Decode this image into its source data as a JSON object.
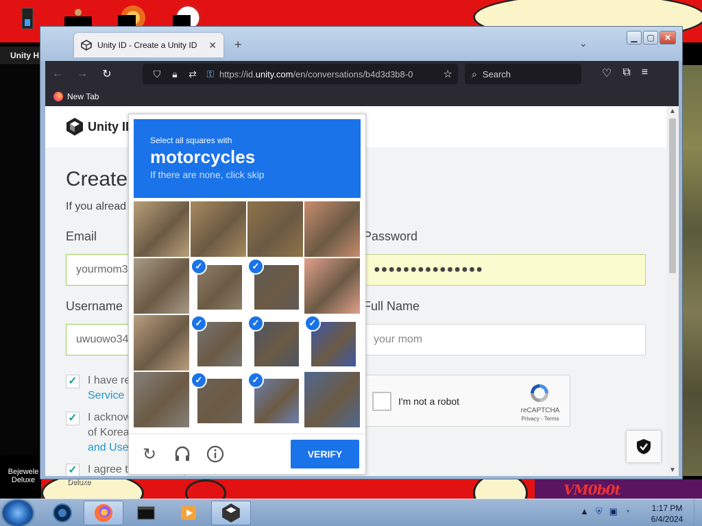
{
  "desktop": {
    "unity_hub_label": "Unity H",
    "left_icon_label": "Bejewele Deluxe",
    "mid_icon_label": "Deluxe",
    "vm_logo": "VM0b0t"
  },
  "browser": {
    "tab_title": "Unity ID - Create a Unity ID",
    "tab_close": "✕",
    "new_tab_symbol": "+",
    "url_prefix": "https://id.",
    "url_domain": "unity.com",
    "url_rest": "/en/conversations/b4d3d3b8-0",
    "search_placeholder": "Search",
    "bookmark_label": "New Tab"
  },
  "page": {
    "logo_text": "Unity ID",
    "title": "Create",
    "subtitle": "If you alread",
    "email_label": "Email",
    "email_value": "yourmom3",
    "password_label": "Password",
    "password_value": "●●●●●●●●●●●●●●●",
    "username_label": "Username",
    "username_value": "uwuowo34",
    "fullname_label": "Full Name",
    "fullname_value": "your mom",
    "check1_line1": "I have re",
    "check1_link": "Service",
    "check2_line1": "I acknow",
    "check2_line2": "of Korea",
    "check2_link": "and Use",
    "check3_line1": "I agree to have Unity...",
    "recaptcha_label": "I'm not a robot",
    "recaptcha_name": "reCAPTCHA",
    "recaptcha_links": "Privacy - Terms"
  },
  "challenge": {
    "instruction": "Select all squares with",
    "target": "motorcycles",
    "hint": "If there are none, click skip",
    "verify_label": "VERIFY",
    "tiles": [
      {
        "selected": false,
        "tone": "#b8a07a"
      },
      {
        "selected": false,
        "tone": "#a78a5e"
      },
      {
        "selected": false,
        "tone": "#8f7448"
      },
      {
        "selected": false,
        "tone": "#c88c6e"
      },
      {
        "selected": false,
        "tone": "#a89a86"
      },
      {
        "selected": true,
        "tone": "#8e7f6a"
      },
      {
        "selected": true,
        "tone": "#5f5a55"
      },
      {
        "selected": false,
        "tone": "#e2a08c"
      },
      {
        "selected": false,
        "tone": "#b89e80"
      },
      {
        "selected": true,
        "tone": "#777573"
      },
      {
        "selected": true,
        "tone": "#4e5564"
      },
      {
        "selected": true,
        "tone": "#3e58a8"
      },
      {
        "selected": false,
        "tone": "#86807a"
      },
      {
        "selected": true,
        "tone": "#6e6256"
      },
      {
        "selected": true,
        "tone": "#6c7fae"
      },
      {
        "selected": false,
        "tone": "#4f6890"
      }
    ]
  },
  "taskbar": {
    "time": "1:17 PM",
    "date": "6/4/2024"
  }
}
